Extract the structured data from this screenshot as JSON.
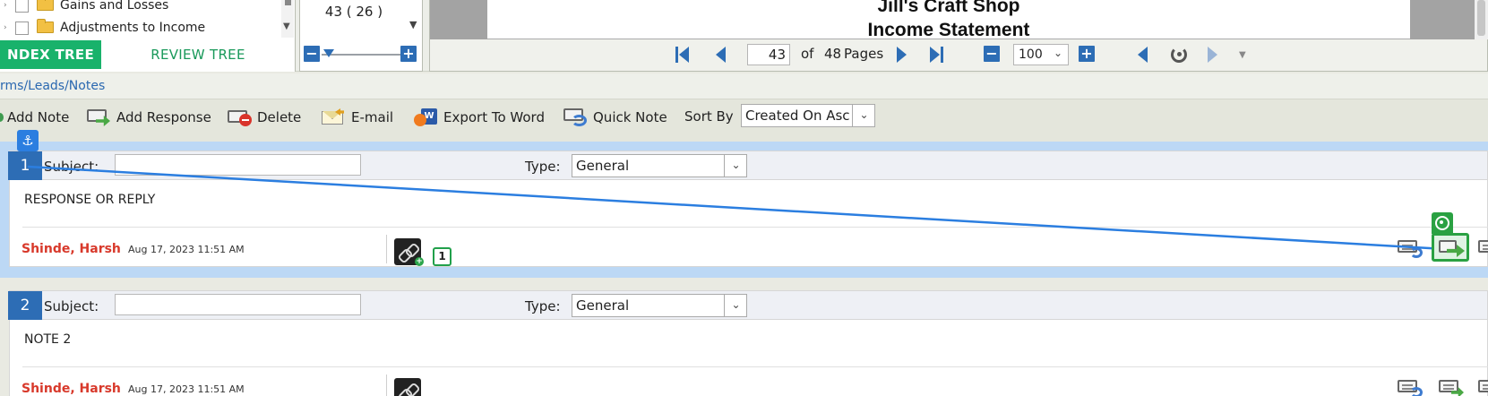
{
  "tree": {
    "items": [
      {
        "label": "Gains and Losses",
        "expander": "›"
      },
      {
        "label": "Adjustments to Income",
        "expander": "›"
      }
    ],
    "tabs": {
      "index": "NDEX TREE",
      "review": "REVIEW TREE"
    }
  },
  "page_select": {
    "value": "43 ( 26 )",
    "arrow": "▼",
    "minus": "−",
    "plus": "+"
  },
  "document": {
    "title_line1": "Jill's Craft Shop",
    "title_line2": "Income Statement"
  },
  "pager": {
    "current_page": "43",
    "of_label": "of",
    "total_pages": "48",
    "pages_label": "Pages",
    "zoom_value": "100",
    "zoom_minus": "−",
    "zoom_plus": "+",
    "dropdown_arrow": "⌄"
  },
  "breadcrumb": "rms/Leads/Notes",
  "toolbar": {
    "add_note": "Add Note",
    "add_response": "Add Response",
    "delete": "Delete",
    "email": "E-mail",
    "export_to_word": "Export To Word",
    "quick_note": "Quick Note",
    "sort_by_label": "Sort By",
    "sort_by_value": "Created On Asc",
    "dropdown_arrow": "⌄"
  },
  "notes": [
    {
      "number": "1",
      "subject_label": "Subject:",
      "subject_value": "",
      "type_label": "Type:",
      "type_value": "General",
      "body": "RESPONSE OR REPLY",
      "author": "Shinde, Harsh",
      "date": "Aug 17, 2023 11:51 AM",
      "link_count": "1"
    },
    {
      "number": "2",
      "subject_label": "Subject:",
      "subject_value": "",
      "type_label": "Type:",
      "type_value": "General",
      "body": "NOTE 2",
      "author": "Shinde, Harsh",
      "date": "Aug 17, 2023 11:51 AM",
      "link_count": ""
    }
  ],
  "overlay": {
    "anchor_glyph": "⚓"
  },
  "colors": {
    "primary_blue": "#2d6db5",
    "tree_tab_green": "#19b26b",
    "author_red": "#d8392b",
    "connector_blue": "#2b7ee0",
    "target_green": "#2aa142",
    "selected_note_bg": "#bcd8f5"
  },
  "icons": {
    "add_note": "add-note-icon",
    "add_response": "add-response-icon",
    "delete": "delete-icon",
    "email": "email-icon",
    "export_to_word": "word-export-icon",
    "quick_note": "quick-note-icon",
    "link": "link-icon",
    "anchor": "anchor-icon",
    "target": "target-icon"
  }
}
